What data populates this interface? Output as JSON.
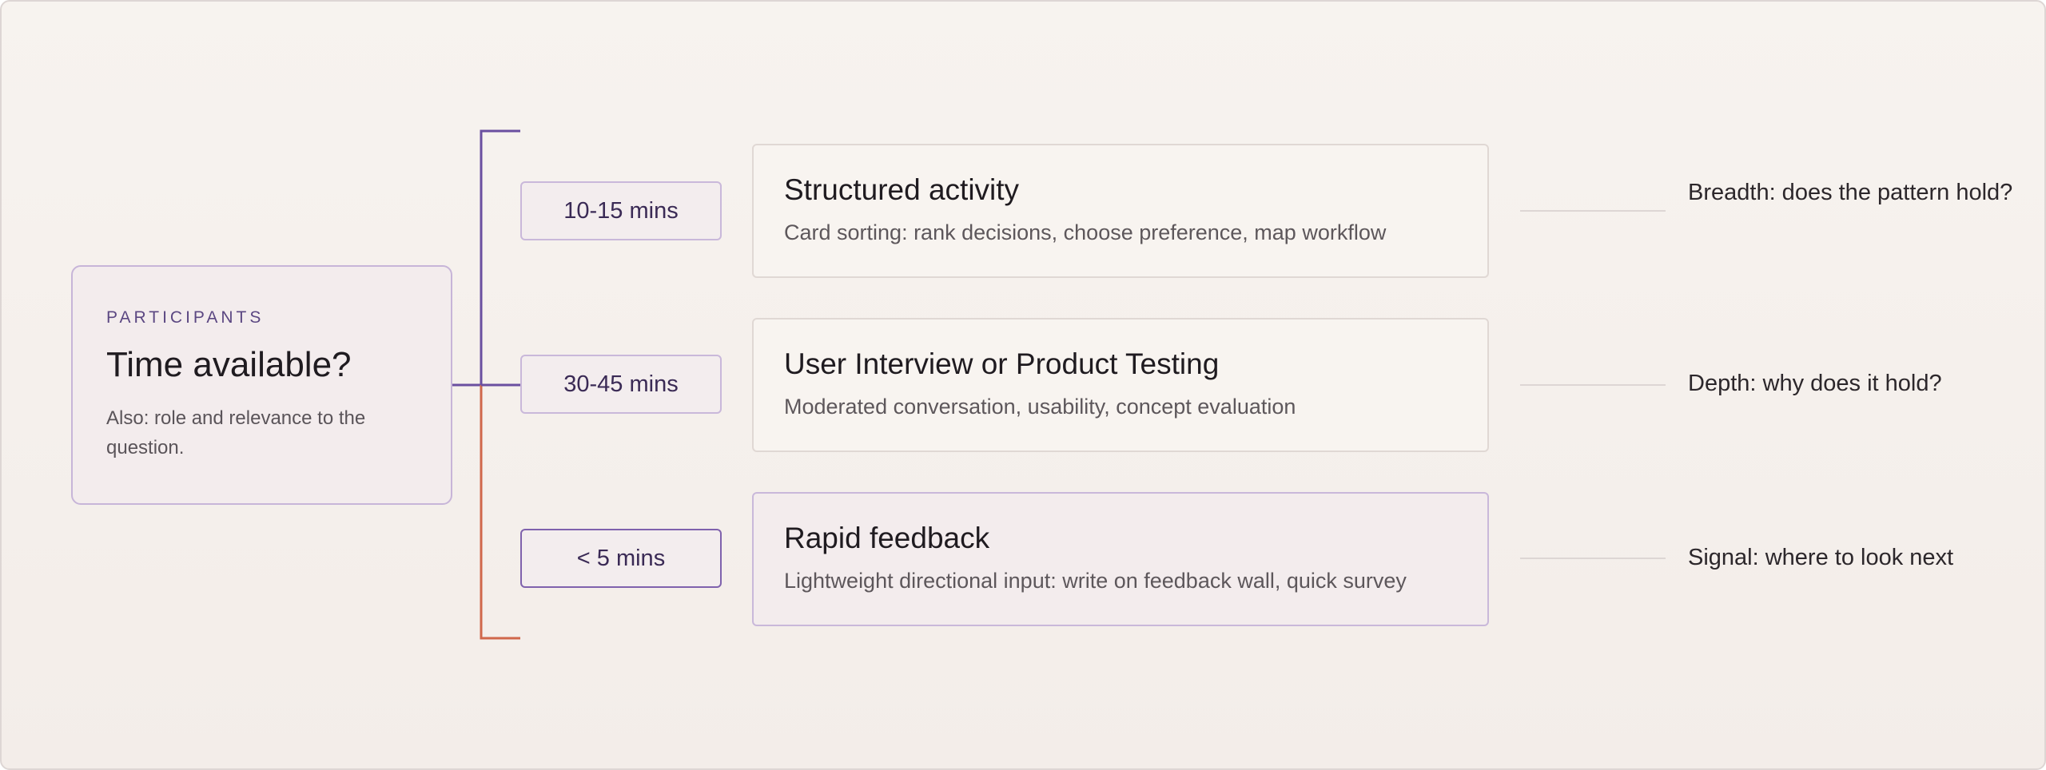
{
  "participants": {
    "eyebrow": "PARTICIPANTS",
    "title": "Time available?",
    "note": "Also: role and relevance to the question."
  },
  "rows": [
    {
      "time": "10-15 mins",
      "method_title": "Structured activity",
      "method_desc": "Card sorting: rank decisions, choose preference, map workflow",
      "outcome": "Breadth: does the pattern hold?"
    },
    {
      "time": "30-45 mins",
      "method_title": "User Interview or Product Testing",
      "method_desc": "Moderated conversation, usability, concept evaluation",
      "outcome": "Depth: why does it hold?"
    },
    {
      "time": "< 5 mins",
      "method_title": "Rapid feedback",
      "method_desc": "Lightweight directional input: write on feedback wall, quick survey",
      "outcome": "Signal: where to look next"
    }
  ],
  "colors": {
    "bracket_top": "#6a4fa0",
    "bracket_bottom": "#d0674b",
    "accent_purple": "#7f62ad",
    "divider": "#ddd6d4"
  }
}
